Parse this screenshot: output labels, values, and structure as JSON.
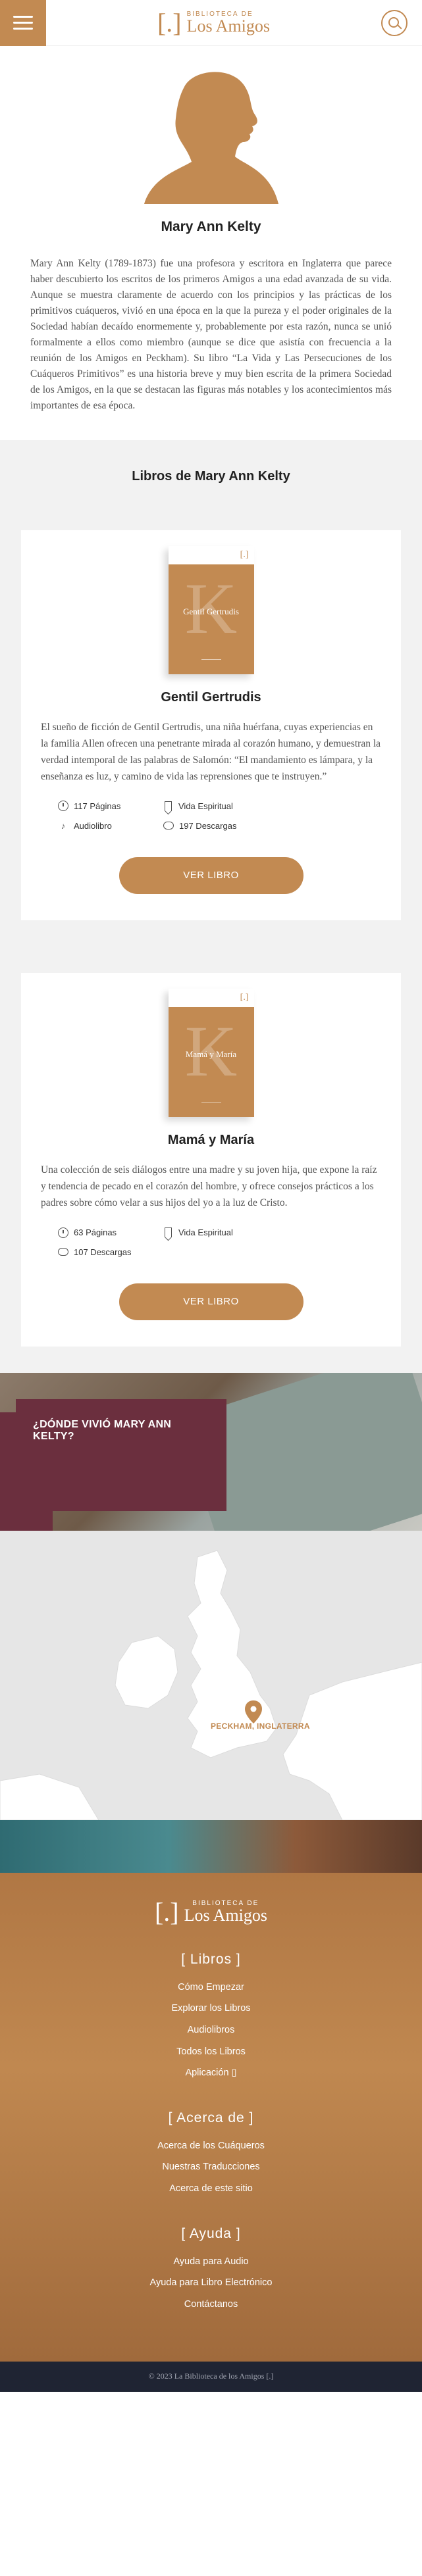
{
  "header": {
    "logo_top": "BIBLIOTECA DE",
    "logo_bottom": "Los Amigos",
    "logo_mark": "[.]"
  },
  "author": {
    "name": "Mary Ann Kelty",
    "bio": "Mary Ann Kelty (1789-1873) fue una profesora y escritora en Inglaterra que parece haber descubierto los escritos de los primeros Amigos a una edad avanzada de su vida. Aunque se muestra claramente de acuerdo con los principios y las prácticas de los primitivos cuáqueros, vivió en una época en la que la pureza y el poder originales de la Sociedad habían decaído enormemente y, probablemente por esta razón, nunca se unió formalmente a ellos como miembro (aunque se dice que asistía con frecuencia a la reunión de los Amigos en Peckham). Su libro “La Vida y Las Persecuciones de los Cuáqueros Primitivos” es una historia breve y muy bien escrita de la primera Sociedad de los Amigos, en la que se destacan las figuras más notables y los acontecimientos más importantes de esa época."
  },
  "books": {
    "section_title": "Libros de Mary Ann Kelty",
    "items": [
      {
        "cover_title": "Gentil Gertrudis",
        "title": "Gentil Gertrudis",
        "description": "El sueño de ficción de Gentil Gertrudis, una niña huérfana, cuyas experiencias en la familia Allen ofrecen una penetrante mirada al corazón humano, y demuestran la verdad intemporal de las palabras de Salomón: “El mandamiento es lámpara, y la enseñanza es luz, y camino de vida las reprensiones que te instruyen.”",
        "pages": "117 Páginas",
        "category": "Vida Espiritual",
        "audio": "Audiolibro",
        "downloads": "197 Descargas",
        "button": "VER LIBRO"
      },
      {
        "cover_title": "Mamá y María",
        "title": "Mamá y María",
        "description": "Una colección de seis diálogos entre una madre y su joven hija, que expone la raíz y tendencia de pecado en el corazón del hombre, y ofrece consejos prácticos a los padres sobre cómo velar a sus hijos del yo a la luz de Cristo.",
        "pages": "63 Páginas",
        "category": "Vida Espiritual",
        "downloads": "107 Descargas",
        "button": "VER LIBRO"
      }
    ]
  },
  "location": {
    "question": "¿DÓNDE VIVIÓ MARY ANN KELTY?",
    "pin_label": "PECKHAM, INGLATERRA"
  },
  "footer": {
    "logo_top": "BIBLIOTECA DE",
    "logo_bottom": "Los Amigos",
    "logo_mark": "[.]",
    "sections": [
      {
        "heading": "[ Libros ]",
        "links": [
          "Cómo Empezar",
          "Explorar los Libros",
          "Audiolibros",
          "Todos los Libros",
          "Aplicación ▯"
        ]
      },
      {
        "heading": "[ Acerca de ]",
        "links": [
          "Acerca de los Cuáqueros",
          "Nuestras Traducciones",
          "Acerca de este sitio"
        ]
      },
      {
        "heading": "[ Ayuda ]",
        "links": [
          "Ayuda para Audio",
          "Ayuda para Libro Electrónico",
          "Contáctanos"
        ]
      }
    ],
    "copyright": "© 2023 La Biblioteca de los Amigos [.]"
  },
  "colors": {
    "accent": "#c28a52",
    "location_box": "#6b2f3e",
    "copyright_bg": "#1f2433"
  }
}
